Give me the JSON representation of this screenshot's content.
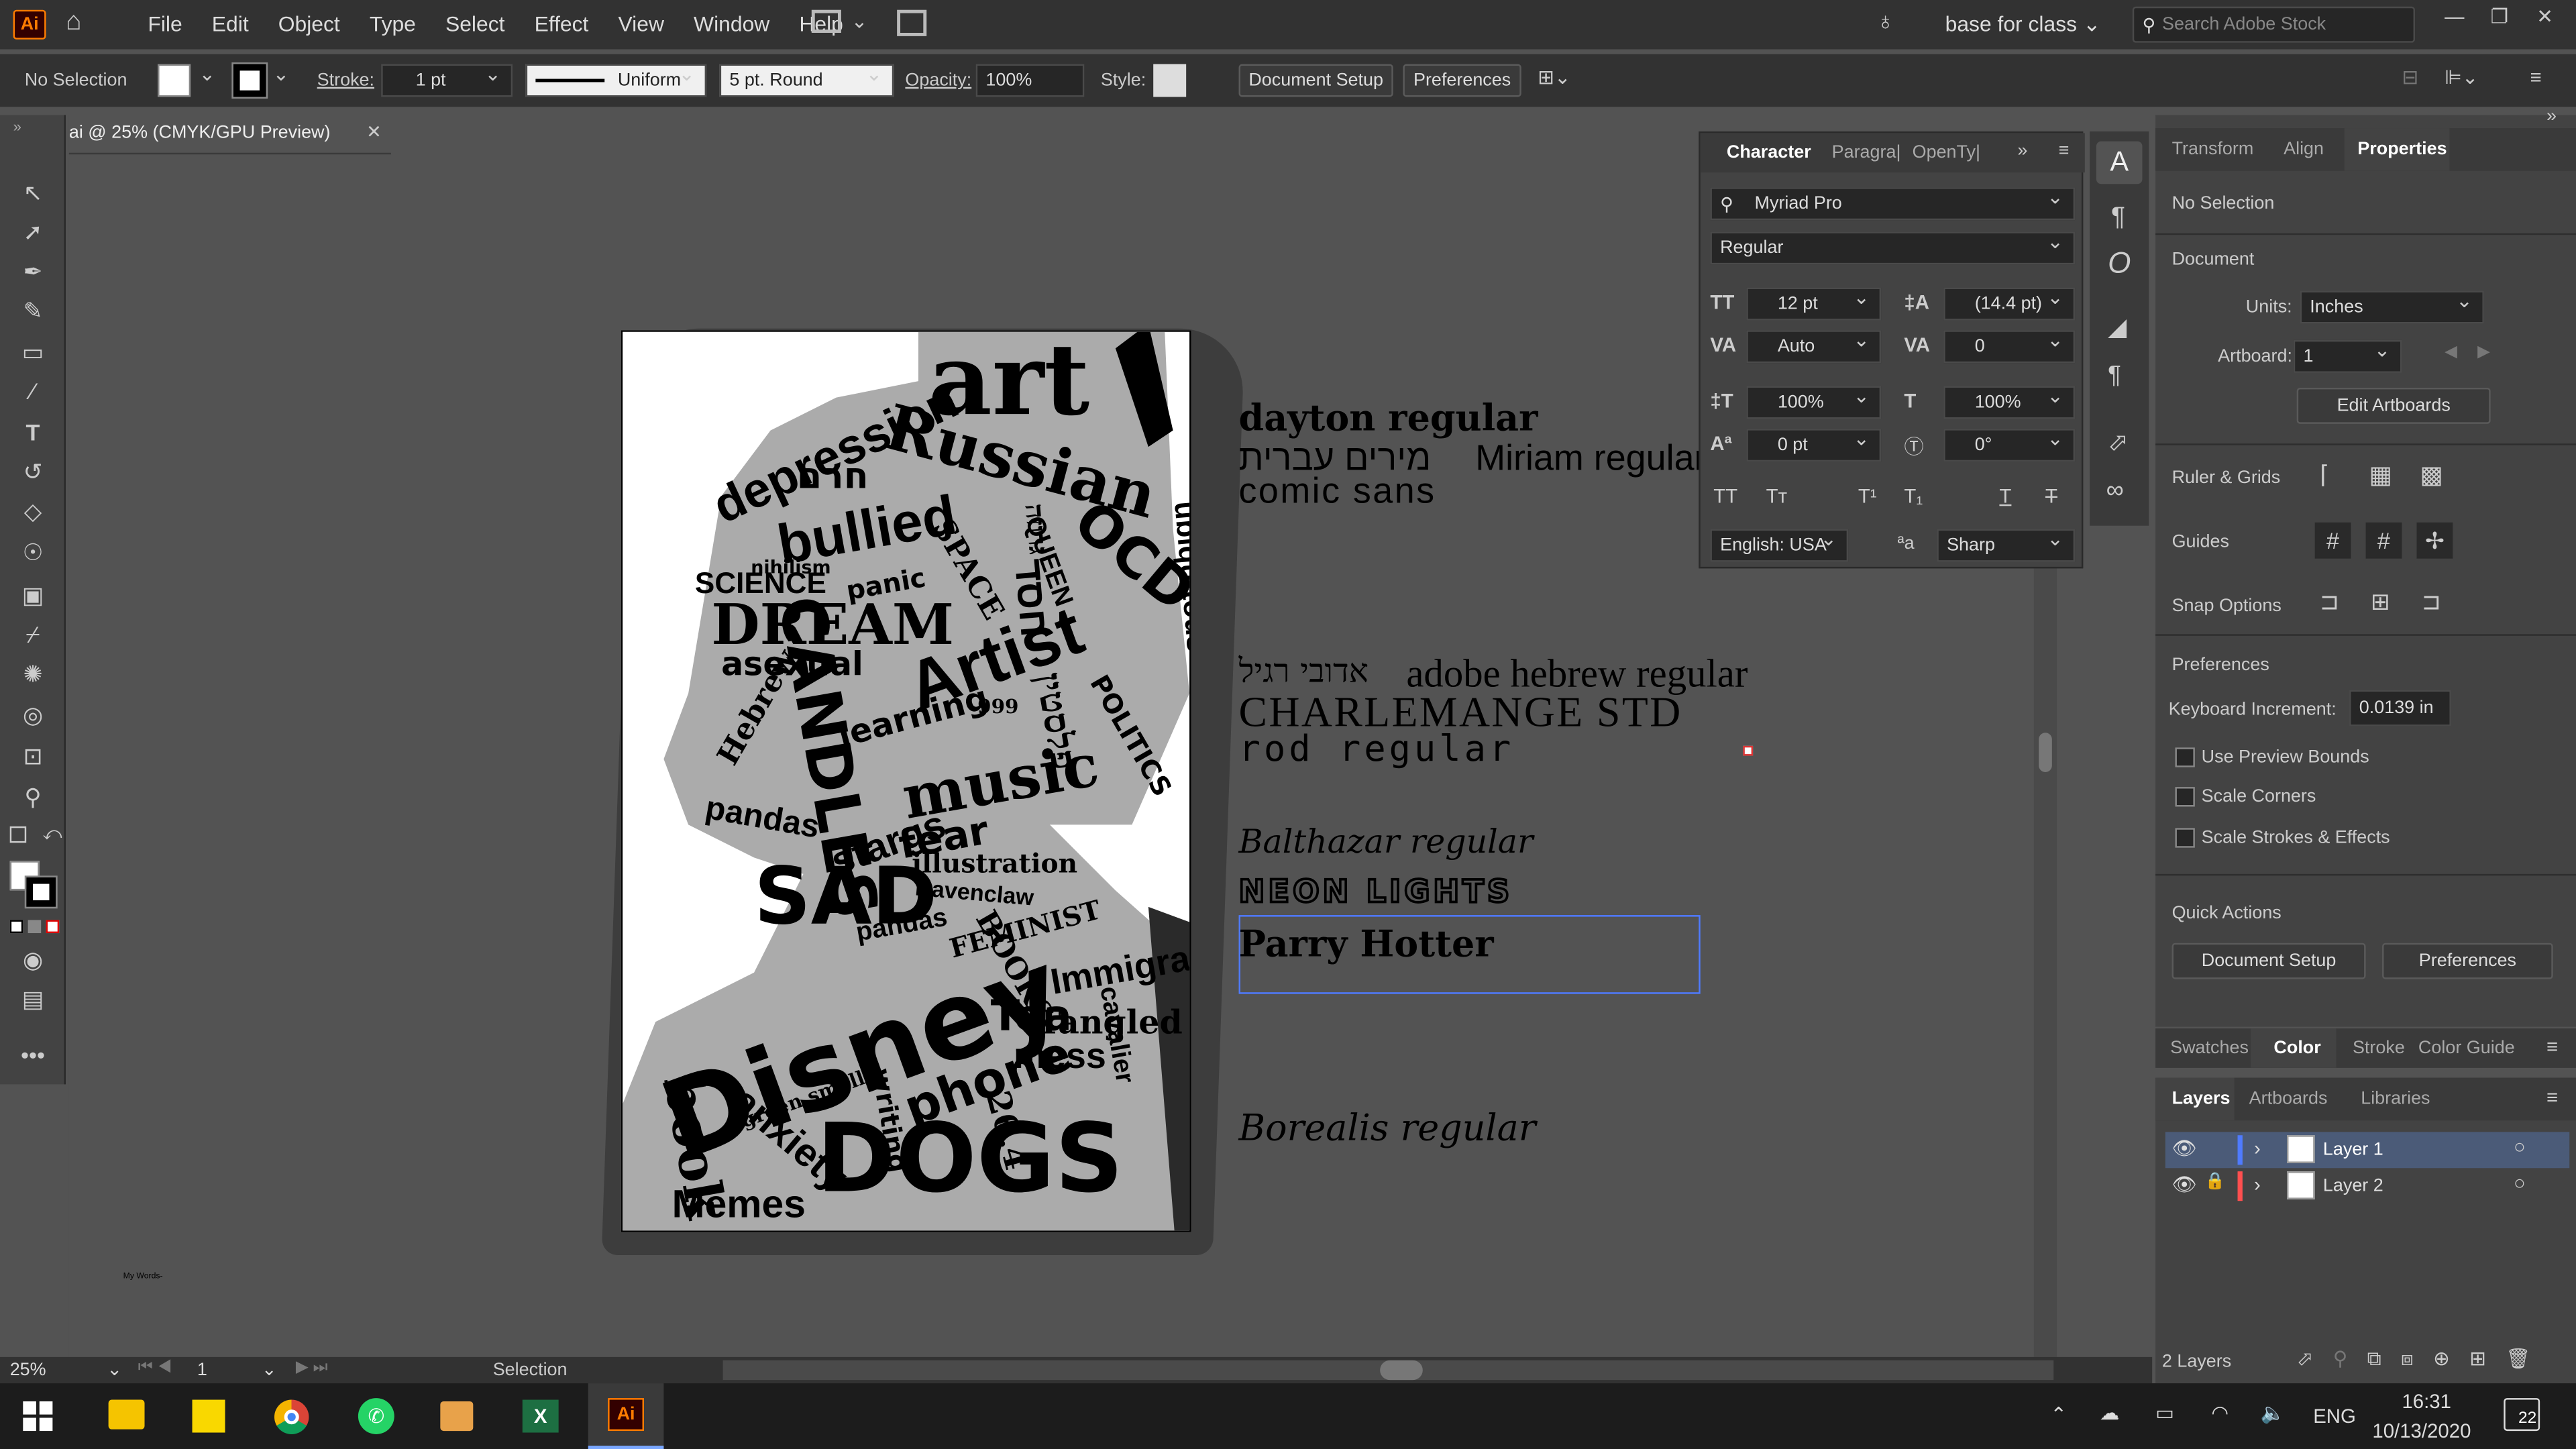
{
  "app": {
    "logo": "Ai"
  },
  "menu": [
    "File",
    "Edit",
    "Object",
    "Type",
    "Select",
    "Effect",
    "View",
    "Window",
    "Help"
  ],
  "workspace": {
    "name": "base for class",
    "search_placeholder": "Search Adobe Stock"
  },
  "control": {
    "selection": "No Selection",
    "stroke_label": "Stroke:",
    "stroke_value": "1 pt",
    "uniform": "Uniform",
    "brush": "5 pt. Round",
    "opacity_label": "Opacity:",
    "opacity_value": "100%",
    "style_label": "Style:",
    "doc_setup": "Document Setup",
    "preferences": "Preferences"
  },
  "doc_tab": {
    "title": "ai @ 25% (CMYK/GPU Preview)"
  },
  "character": {
    "tabs": [
      "Character",
      "Paragra|",
      "OpenTy|"
    ],
    "font": "Myriad Pro",
    "style": "Regular",
    "size": "12 pt",
    "leading": "(14.4 pt)",
    "kerning": "Auto",
    "tracking": "0",
    "vscale": "100%",
    "hscale": "100%",
    "baseline": "0 pt",
    "rotation": "0°",
    "language": "English: USA",
    "aa": "Sharp"
  },
  "properties": {
    "tabs": [
      "Transform",
      "Align",
      "Properties"
    ],
    "selection": "No Selection",
    "document": "Document",
    "units_label": "Units:",
    "units": "Inches",
    "artboard_label": "Artboard:",
    "artboard": "1",
    "edit_artboards": "Edit Artboards",
    "ruler_grids": "Ruler & Grids",
    "guides": "Guides",
    "snap": "Snap Options",
    "preferences": "Preferences",
    "kb_label": "Keyboard Increment:",
    "kb_value": "0.0139 in",
    "use_preview": "Use Preview Bounds",
    "scale_corners": "Scale Corners",
    "scale_strokes": "Scale Strokes & Effects",
    "quick_actions": "Quick Actions",
    "doc_setup": "Document Setup",
    "prefs_btn": "Preferences"
  },
  "color_tabs": [
    "Swatches",
    "Color",
    "Stroke",
    "Color Guide"
  ],
  "layers": {
    "tabs": [
      "Layers",
      "Artboards",
      "Libraries"
    ],
    "items": [
      {
        "name": "Layer 1",
        "color": "#4f7bff"
      },
      {
        "name": "Layer 2",
        "color": "#ff4f4f"
      }
    ],
    "count": "2 Layers"
  },
  "status": {
    "zoom": "25%",
    "artboard": "1",
    "tool": "Selection"
  },
  "canvas_text": {
    "dayton": "dayton regular",
    "hebrew1": "מירים עברית",
    "miriam": "Miriam regular",
    "comic": "comic sans",
    "adobi": "אדובי רגיל",
    "adobe_hebrew": "adobe hebrew regular",
    "charlemange": "CHARLEMANGE STD",
    "rod": "rod regular",
    "balthazar": "Balthazar regular",
    "neon": "NEON LIGHTS",
    "parry": "Parry Hotter",
    "borealis": "Borealis regular",
    "my_words": "My Words-"
  },
  "portrait_words": [
    "art",
    "depression",
    "חרם",
    "Russian",
    "bullied",
    "nihilism",
    "גרוזה",
    "SCIENCE",
    "panic",
    "SPACE",
    "QUEEN",
    "OCD",
    "DREAM",
    "חסד",
    "asexual",
    "Hebrew",
    "Artist",
    "learning",
    "999",
    "ubiquitous",
    "CANDLES",
    "music",
    "pandas",
    "POLITICS",
    "פלסטין",
    "stargs",
    "fear",
    "illustration",
    "Ravenclaw",
    "SAD",
    "FEMINIST",
    "pandas",
    "Disney",
    "BOOKS",
    "Immigrant",
    "Tea",
    "Tangled",
    "mess",
    "phone",
    "green smells",
    "anxiety",
    "DOGS",
    "26.4",
    "Memes",
    "writing",
    "book",
    "cavalier"
  ],
  "taskbar": {
    "lang": "ENG",
    "time": "16:31",
    "date": "10/13/2020",
    "notif": "22"
  }
}
